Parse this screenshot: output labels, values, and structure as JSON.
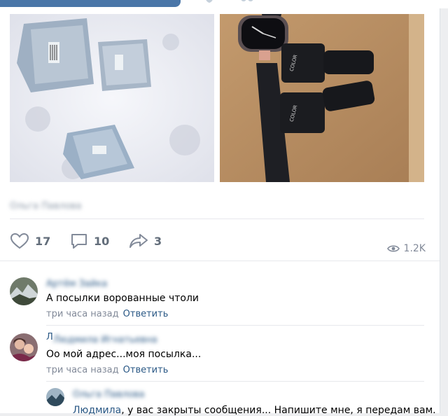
{
  "post": {
    "author_blurred": "Ольга Павлова",
    "likes": "17",
    "comments": "10",
    "shares": "3",
    "views": "1.2K"
  },
  "comments": [
    {
      "author_blurred": "Артём Зайка",
      "text": "А посылки ворованные чтоли",
      "time": "три часа назад",
      "reply_label": "Ответить"
    },
    {
      "author_initial": "Л",
      "author_blurred": "Людмила Игнатьевна",
      "text": "Оо мой адрес...моя посылка...",
      "time": "три часа назад",
      "reply_label": "Ответить"
    }
  ],
  "reply": {
    "author_blurred": "Ольга Павлова",
    "mention": "Людмила",
    "text": ", у вас закрыты сообщения... Напишите мне, я передам вам."
  },
  "icons": {
    "like": "heart-icon",
    "comment": "comment-icon",
    "share": "share-icon",
    "views": "eye-icon"
  },
  "colors": {
    "link": "#2a5885",
    "meta": "#828a99",
    "action": "#626d7a",
    "header": "#4a76a8"
  }
}
